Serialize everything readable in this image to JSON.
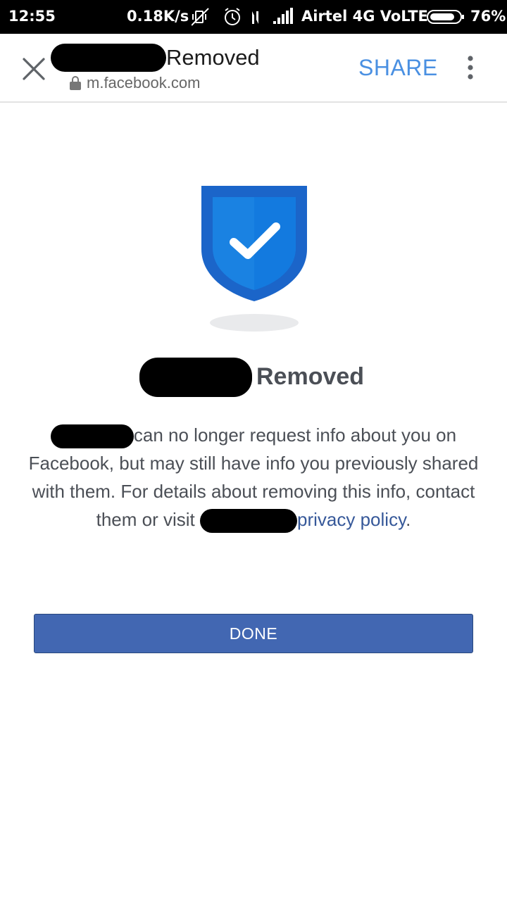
{
  "status_bar": {
    "time": "12:55",
    "net_speed": "0.18K/s",
    "carrier": "Airtel 4G VoLTE",
    "battery": "76%"
  },
  "toolbar": {
    "title": "Removed",
    "url": "m.facebook.com",
    "share_label": "SHARE",
    "icons": [
      "close-icon",
      "lock-icon",
      "more-vert-icon"
    ]
  },
  "main": {
    "heading": "Removed",
    "body_part1": "can no longer request info about you on Facebook, but may still have info you previously shared with them. For details about removing this info, contact them or visit",
    "link_text_1": "privacy",
    "link_text_2": "policy",
    "body_end": ".",
    "done_label": "DONE",
    "icon": "shield-check-icon"
  },
  "colors": {
    "accent": "#4267b2",
    "link": "#365899",
    "share": "#4a90e2",
    "shield_dark": "#1b65c9",
    "shield_light": "#1a82e2"
  }
}
